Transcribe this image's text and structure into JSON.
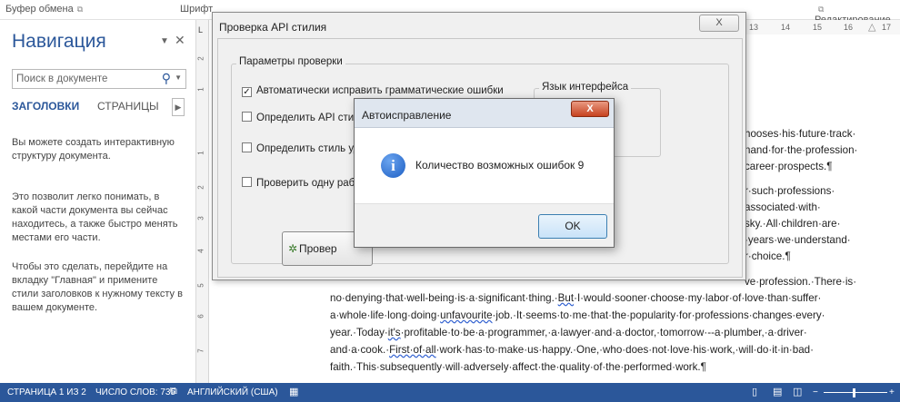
{
  "ribbon": {
    "clipboard": "Буфер обмена",
    "font": "Шрифт",
    "editing": "Редактирование"
  },
  "hruler": [
    "13",
    "14",
    "15",
    "16",
    "17"
  ],
  "vruler": [
    "2",
    "1",
    "1",
    "2",
    "3",
    "4",
    "5",
    "6",
    "7"
  ],
  "nav": {
    "title": "Навигация",
    "search_placeholder": "Поиск в документе",
    "tab_headings": "ЗАГОЛОВКИ",
    "tab_pages": "СТРАНИЦЫ",
    "p1": "Вы можете создать интерактивную структуру документа.",
    "p2": "Это позволит легко понимать, в какой части документа вы сейчас находитесь, а также быстро менять местами его части.",
    "p3": "Чтобы это сделать, перейдите на вкладку \"Главная\" и примените стили заголовков к нужному тексту в вашем документе."
  },
  "doc": {
    "right_lines": [
      "hooses·his·future·track·",
      "nand·for·the·profession·",
      "career·prospects.¶",
      "r·such·professions·",
      "associated·with·",
      "sky.·All·children·are·",
      "·years·we·understand·",
      "r·choice.¶",
      "ve·profession.·There·is·"
    ],
    "l1a": "no·denying·that·well-being·is·a·significant·thing.·",
    "l1b": "But",
    "l1c": "·I·would·sooner·choose·my·labor·of·love·than·suffer·",
    "l2a": "a·whole·life·long·doing·",
    "l2b": "unfavourite",
    "l2c": "·job.·It·seems·to·me·that·the·popularity·for·professions·changes·every·",
    "l3a": "year.·Today·",
    "l3b": "it's",
    "l3c": "·profitable·to·be·a·programmer,·a·lawyer·and·a·doctor,·tomorrow·--a·plumber,·a·driver·",
    "l4a": "and·a·cook.·",
    "l4b": "First·of·all",
    "l4c": "·work·has·to·make·us·happy.·One,·who·does·not·love·his·work,·will·do·it·in·bad·",
    "l5": "faith.·This·subsequently·will·adversely·affect·the·quality·of·the·performed·work.¶"
  },
  "dialog": {
    "title": "Проверка API стилия",
    "group_label": "Параметры проверки",
    "opt_autofix": "Автоматически исправить грамматические ошибки",
    "opt_api": "Определить API стиль",
    "opt_style": "Определить стиль удо",
    "opt_single": "Проверить одну рабо",
    "lang_label": "Язык интерфейса",
    "check_button": "Провер",
    "close": "X"
  },
  "popup": {
    "title": "Автоисправление",
    "message": "Количество возможных ошибок 9",
    "ok": "OK",
    "close": "X"
  },
  "status": {
    "page": "СТРАНИЦА 1 ИЗ 2",
    "words": "ЧИСЛО СЛОВ: 735",
    "lang": "АНГЛИЙСКИЙ (США)"
  }
}
